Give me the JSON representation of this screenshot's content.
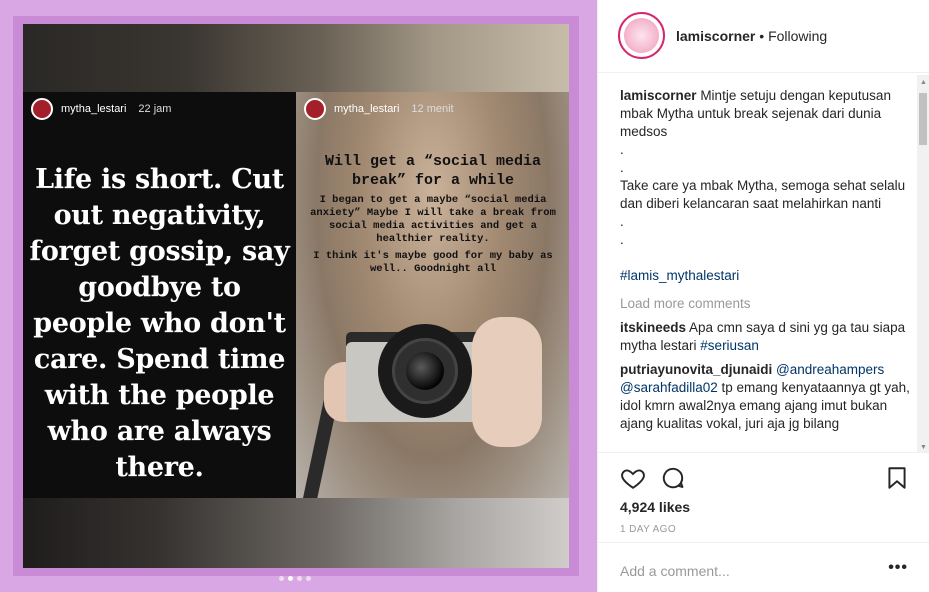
{
  "post": {
    "author": "lamiscorner",
    "separator": "•",
    "follow_status": "Following"
  },
  "media": {
    "left_story": {
      "username": "mytha_lestari",
      "time": "22 jam",
      "quote": "Life is short. Cut out negativity, forget gossip, say goodbye to people who don't care. Spend time with the people who are always there."
    },
    "right_story": {
      "username": "mytha_lestari",
      "time": "12 menit",
      "headline": "Will get a “social media break” for a while",
      "body": "I began to get a maybe “social media anxiety” Maybe I will take a break from social media activities and get a healthier reality.",
      "body2": "I think it's maybe good for my baby as well.. Goodnight all"
    },
    "carousel_dots": 4,
    "active_dot": 1
  },
  "caption": {
    "user": "lamiscorner",
    "line1": "Mintje setuju dengan keputusan mbak Mytha untuk break sejenak dari dunia medsos",
    "dot1": ".",
    "dot2": ".",
    "line2": "Take care ya mbak Mytha, semoga sehat selalu dan diberi kelancaran saat melahirkan nanti",
    "dot3": ".",
    "dot4": ".",
    "hashtag": "#lamis_mythalestari"
  },
  "load_more": "Load more comments",
  "comments": [
    {
      "user": "itskineeds",
      "text": "Apa cmn saya d sini yg ga tau siapa mytha lestari",
      "tag": "#seriusan"
    },
    {
      "user": "putriayunovita_djunaidi",
      "mention1": "@andreahampers",
      "mention2": "@sarahfadilla02",
      "text": "tp emang kenyataannya gt yah, idol kmrn awal2nya emang ajang imut bukan ajang kualitas vokal, juri aja jg bilang"
    }
  ],
  "likes": "4,924 likes",
  "time_ago": "1 DAY AGO",
  "add_comment_placeholder": "Add a comment...",
  "more_options": "•••",
  "icons": {
    "like": "heart-icon",
    "comment": "comment-icon",
    "save": "bookmark-icon",
    "more": "more-options-icon"
  },
  "colors": {
    "frame_outer": "#d9a7e4",
    "frame_inner": "#c98ad6",
    "link": "#003569",
    "muted": "#999999",
    "text": "#262626"
  }
}
